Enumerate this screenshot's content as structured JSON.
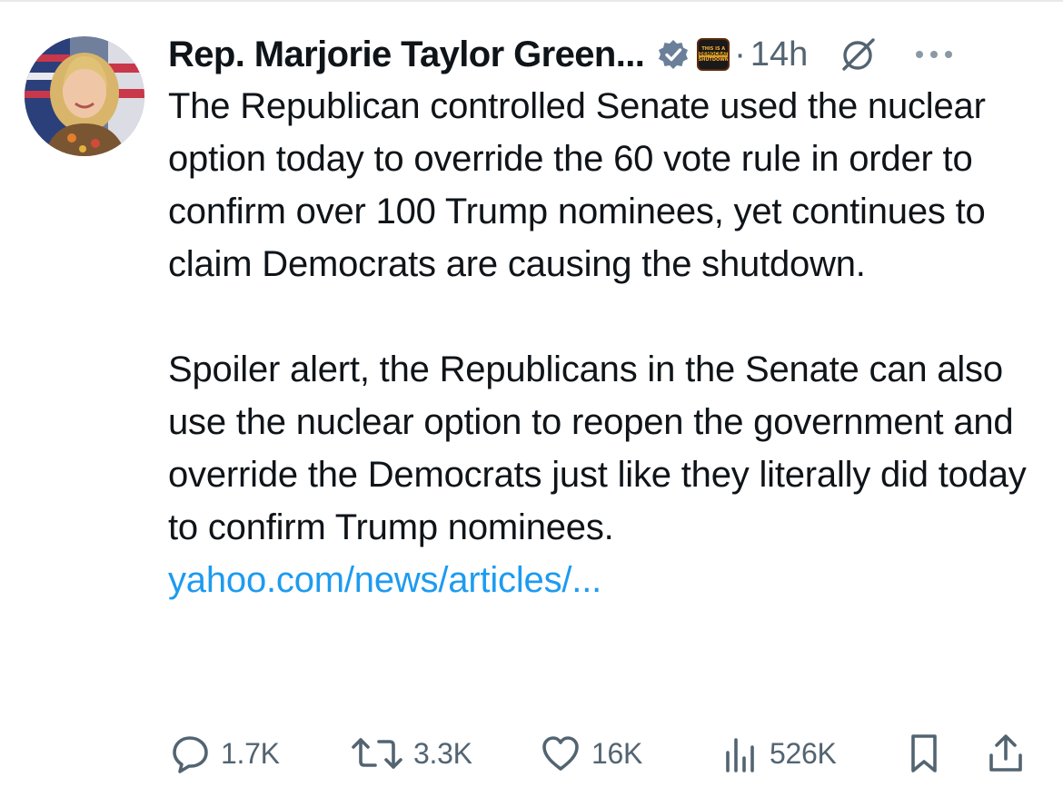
{
  "author": {
    "display_name": "Rep. Marjorie Taylor Green...",
    "verified_icon": "verified-badge-icon",
    "affiliate_badge_lines": [
      "THIS IS A",
      "DEMOCRAT",
      "SHUTDOWN"
    ],
    "separator": "·",
    "timestamp": "14h"
  },
  "header_icons": {
    "grok": "grok-icon",
    "more": "more-options-icon"
  },
  "tweet": {
    "paragraph_1": "The Republican controlled Senate used the nuclear option today to override the 60 vote rule in order to confirm over 100 Trump nominees, yet continues to claim Democrats are causing the shutdown.",
    "paragraph_2": "Spoiler alert, the Republicans in the Senate can also use the nuclear option to reopen the government and override the Democrats just like they literally did today to confirm Trump nominees.",
    "link_text": "yahoo.com/news/articles/..."
  },
  "actions": {
    "replies": "1.7K",
    "reposts": "3.3K",
    "likes": "16K",
    "views": "526K"
  },
  "colors": {
    "text": "#0f1419",
    "muted": "#536471",
    "link": "#1d9bf0",
    "verified": "#1d9bf0"
  }
}
